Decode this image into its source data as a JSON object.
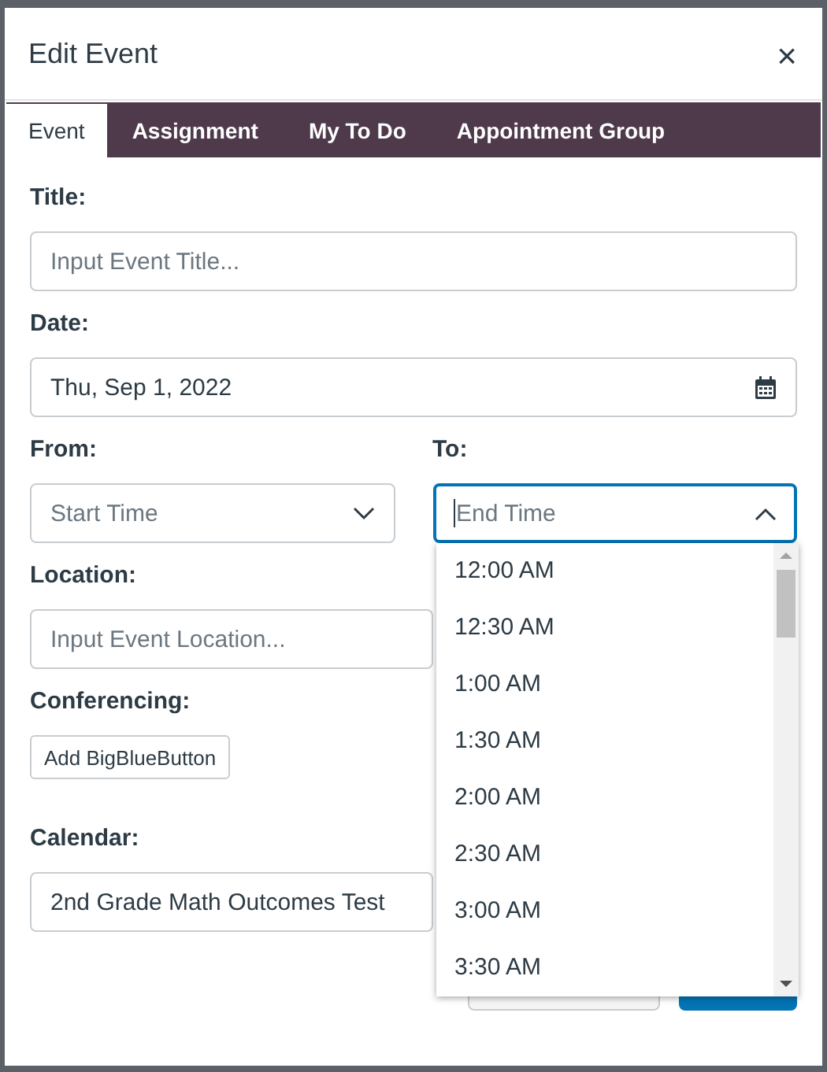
{
  "dialog": {
    "title": "Edit Event",
    "close": "×"
  },
  "tabs": [
    {
      "label": "Event",
      "selected": true
    },
    {
      "label": "Assignment",
      "selected": false
    },
    {
      "label": "My To Do",
      "selected": false
    },
    {
      "label": "Appointment Group",
      "selected": false
    }
  ],
  "title_field": {
    "label": "Title:",
    "placeholder": "Input Event Title..."
  },
  "date_field": {
    "label": "Date:",
    "value": "Thu, Sep 1, 2022"
  },
  "time_range": [
    {
      "label": "From:",
      "placeholder": "Start Time",
      "expanded": false
    },
    {
      "label": "To:",
      "placeholder": "End Time",
      "expanded": true,
      "options": [
        "12:00 AM",
        "12:30 AM",
        "1:00 AM",
        "1:30 AM",
        "2:00 AM",
        "2:30 AM",
        "3:00 AM",
        "3:30 AM"
      ]
    }
  ],
  "location_field": {
    "label": "Location:",
    "placeholder": "Input Event Location..."
  },
  "conferencing": {
    "label": "Conferencing:",
    "button": "Add BigBlueButton"
  },
  "calendar_field": {
    "label": "Calendar:",
    "value": "2nd Grade Math Outcomes Test"
  }
}
